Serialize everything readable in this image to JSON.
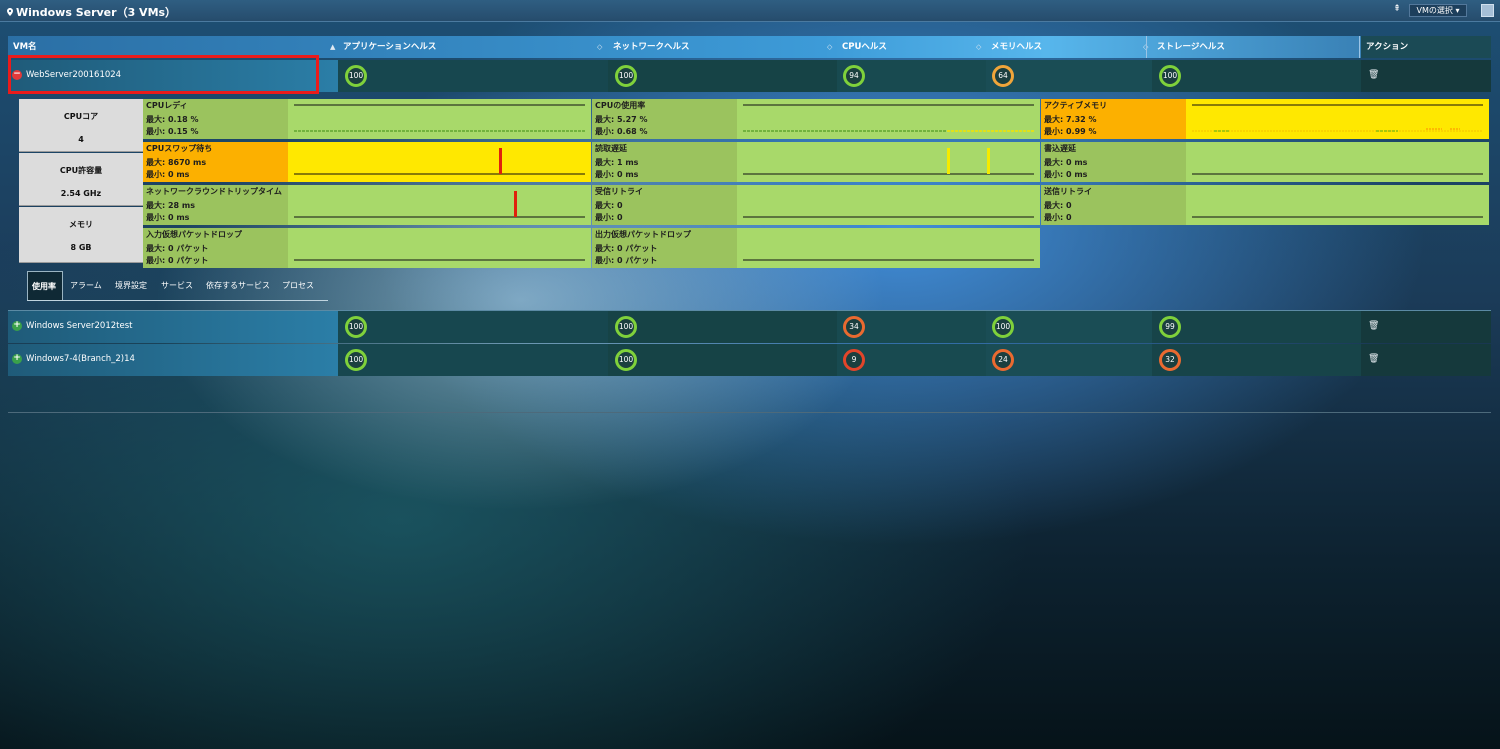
{
  "header": {
    "title": "Windows Server（3 VMs）",
    "vm_select_label": "VMの選択 ▾",
    "pin_label": "⇞"
  },
  "columns": [
    {
      "key": "vm",
      "label": "VM名"
    },
    {
      "key": "app",
      "label": "アプリケーションヘルス"
    },
    {
      "key": "net",
      "label": "ネットワークヘルス"
    },
    {
      "key": "cpu",
      "label": "CPUヘルス"
    },
    {
      "key": "mem",
      "label": "メモリヘルス"
    },
    {
      "key": "storage",
      "label": "ストレージヘルス"
    },
    {
      "key": "action",
      "label": "アクション"
    }
  ],
  "vms": [
    {
      "name": "WebServer200161024",
      "expanded": true,
      "app": "100",
      "net": "100",
      "cpu": "94",
      "mem": "64",
      "storage": "100",
      "app_color": "#7fd13b",
      "net_color": "#7fd13b",
      "cpu_color": "#7fd13b",
      "mem_color": "#f0a53a",
      "storage_color": "#7fd13b"
    },
    {
      "name": "Windows Server2012test",
      "expanded": false,
      "app": "100",
      "net": "100",
      "cpu": "34",
      "mem": "100",
      "storage": "99",
      "app_color": "#7fd13b",
      "net_color": "#7fd13b",
      "cpu_color": "#ea6a30",
      "mem_color": "#7fd13b",
      "storage_color": "#7fd13b"
    },
    {
      "name": "Windows7-4(Branch_2)14",
      "expanded": false,
      "app": "100",
      "net": "100",
      "cpu": "9",
      "mem": "24",
      "storage": "32",
      "app_color": "#7fd13b",
      "net_color": "#7fd13b",
      "cpu_color": "#e2452a",
      "mem_color": "#ea6a30",
      "storage_color": "#ea6a30"
    }
  ],
  "specs": [
    {
      "label": "CPUコア",
      "value": "4"
    },
    {
      "label": "CPU許容量",
      "value": "2.54 GHz"
    },
    {
      "label": "メモリ",
      "value": "8 GB"
    }
  ],
  "metrics": {
    "cpu_ready": {
      "name": "CPUレディ",
      "max": "最大: 0.18 %",
      "min": "最小: 0.15 %"
    },
    "cpu_usage": {
      "name": "CPUの使用率",
      "max": "最大: 5.27 %",
      "min": "最小: 0.68 %"
    },
    "active_memory": {
      "name": "アクティブメモリ",
      "max": "最大: 7.32 %",
      "min": "最小: 0.99 %"
    },
    "cpu_swap_wait": {
      "name": "CPUスワップ待ち",
      "max": "最大: 8670 ms",
      "min": "最小: 0 ms"
    },
    "read_latency": {
      "name": "読取遅延",
      "max": "最大: 1 ms",
      "min": "最小: 0 ms"
    },
    "write_latency": {
      "name": "書込遅延",
      "max": "最大: 0 ms",
      "min": "最小: 0 ms"
    },
    "net_rtt": {
      "name": "ネットワークラウンドトリップタイム",
      "max": "最大: 28 ms",
      "min": "最小: 0 ms"
    },
    "rx_retry": {
      "name": "受信リトライ",
      "max": "最大: 0",
      "min": "最小: 0"
    },
    "tx_retry": {
      "name": "送信リトライ",
      "max": "最大: 0",
      "min": "最小: 0"
    },
    "rx_drop": {
      "name": "入力仮想パケットドロップ",
      "max": "最大: 0 パケット",
      "min": "最小: 0 パケット"
    },
    "tx_drop": {
      "name": "出力仮想パケットドロップ",
      "max": "最大: 0 パケット",
      "min": "最小: 0 パケット"
    }
  },
  "tabs": [
    "使用率",
    "アラーム",
    "境界設定",
    "サービス",
    "依存するサービス",
    "プロセス"
  ],
  "colors": {
    "healthy": "#7fd13b",
    "warning": "#f0a53a",
    "critical": "#e2452a",
    "highlight": "#ea1b1b"
  }
}
